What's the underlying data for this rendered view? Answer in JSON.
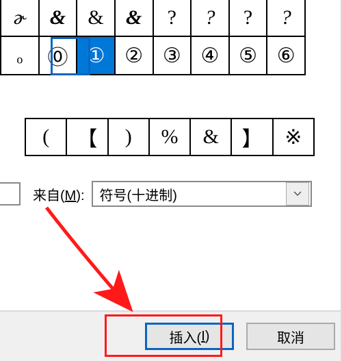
{
  "grid": {
    "row1": [
      "ɚ",
      "&",
      "&",
      "&",
      "?",
      "?",
      "?",
      "?"
    ],
    "row2": [
      "ₒ",
      "⓪",
      "①",
      "②",
      "③",
      "④",
      "⑤",
      "⑥"
    ],
    "selected_index": 2
  },
  "recent": [
    "(",
    "【",
    ")",
    "%",
    "&",
    "】",
    "※"
  ],
  "from": {
    "label_pre": "来自(",
    "label_key": "M",
    "label_post": "):",
    "value": "符号(十进制)"
  },
  "buttons": {
    "insert_pre": "插入(",
    "insert_key": "I",
    "insert_post": ")",
    "cancel": "取消"
  }
}
